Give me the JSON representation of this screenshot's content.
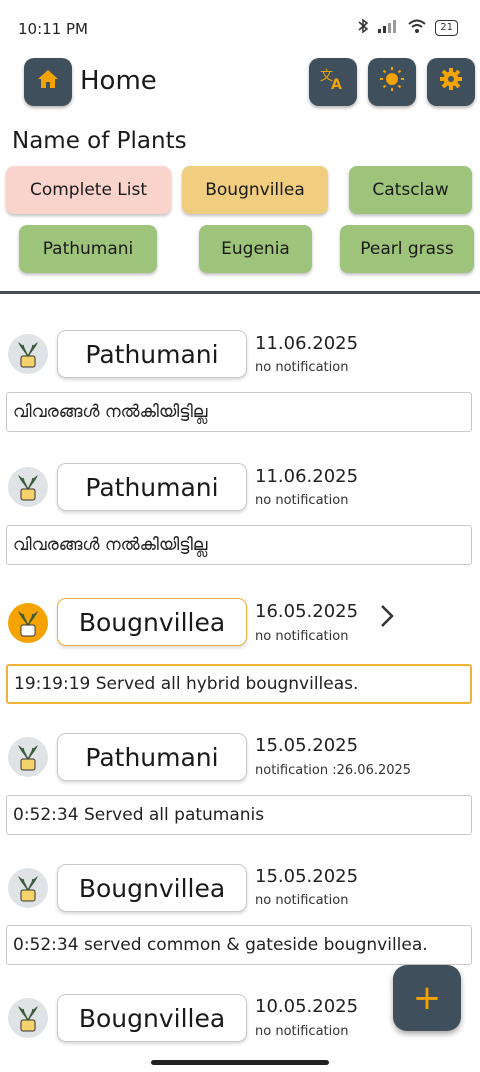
{
  "status_bar": {
    "time": "10:11 PM",
    "battery": "21"
  },
  "app_bar": {
    "title": "Home"
  },
  "section_title": "Name of Plants",
  "chips": [
    {
      "label": "Complete List",
      "color": "#f9d3cc"
    },
    {
      "label": "Bougnvillea",
      "color": "#f0cd7f"
    },
    {
      "label": "Catsclaw",
      "color": "#9dc47a"
    },
    {
      "label": "Pathumani",
      "color": "#9dc47a"
    },
    {
      "label": "Eugenia",
      "color": "#9dc47a"
    },
    {
      "label": "Pearl grass",
      "color": "#9dc47a"
    }
  ],
  "entries": [
    {
      "name": "Pathumani",
      "date": "11.06.2025",
      "notification": "no notification",
      "description": "വിവരങ്ങൾ നൽകിയിട്ടില്ല"
    },
    {
      "name": "Pathumani",
      "date": "11.06.2025",
      "notification": "no notification",
      "description": "വിവരങ്ങൾ നൽകിയിട്ടില്ല"
    },
    {
      "name": "Bougnvillea",
      "date": "16.05.2025",
      "notification": "no notification",
      "description": "19:19:19 Served all hybrid bougnvilleas."
    },
    {
      "name": "Pathumani",
      "date": "15.05.2025",
      "notification": "notification :26.06.2025",
      "description": "0:52:34 Served all patumanis"
    },
    {
      "name": "Bougnvillea",
      "date": "15.05.2025",
      "notification": "no notification",
      "description": "0:52:34 served common & gateside bougnvillea."
    },
    {
      "name": "Bougnvillea",
      "date": "10.05.2025",
      "notification": "no notification"
    }
  ],
  "fab": {
    "symbol": "+"
  },
  "colors": {
    "accent": "#f4a300",
    "button_bg": "#3f4f5c",
    "chip_green": "#9dc47a",
    "chip_yellow": "#f0cd7f",
    "chip_pink": "#f9d3cc"
  }
}
